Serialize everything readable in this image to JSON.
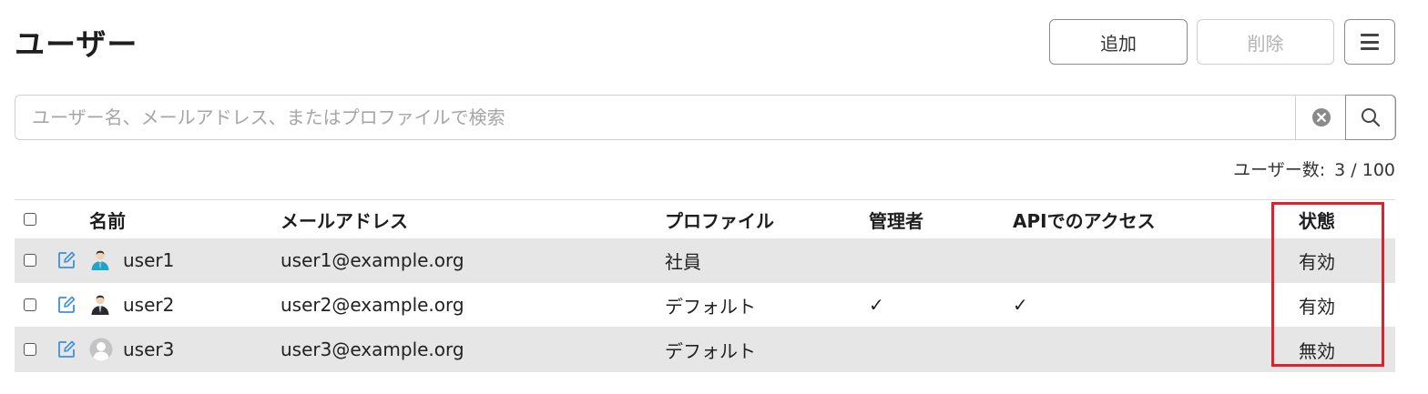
{
  "page": {
    "title": "ユーザー"
  },
  "toolbar": {
    "add_label": "追加",
    "delete_label": "削除",
    "menu_icon": "hamburger-menu-icon"
  },
  "search": {
    "placeholder": "ユーザー名、メールアドレス、またはプロファイルで検索",
    "value": "",
    "clear_icon": "clear-circle-icon",
    "search_icon": "magnifier-icon"
  },
  "user_count": {
    "label": "ユーザー数:",
    "value": "3 / 100"
  },
  "table": {
    "headers": {
      "name": "名前",
      "email": "メールアドレス",
      "profile": "プロファイル",
      "admin": "管理者",
      "api": "APIでのアクセス",
      "status": "状態"
    },
    "rows": [
      {
        "name": "user1",
        "email": "user1@example.org",
        "profile": "社員",
        "admin": "",
        "api": "",
        "status": "有効",
        "avatar": "user-teal-tie-icon"
      },
      {
        "name": "user2",
        "email": "user2@example.org",
        "profile": "デフォルト",
        "admin": "✓",
        "api": "✓",
        "status": "有効",
        "avatar": "user-black-tie-icon"
      },
      {
        "name": "user3",
        "email": "user3@example.org",
        "profile": "デフォルト",
        "admin": "",
        "api": "",
        "status": "無効",
        "avatar": "user-gray-default-icon"
      }
    ]
  },
  "colors": {
    "highlight": "#e0202a",
    "edit_icon": "#3d8fe0",
    "row_shade": "#e6e6e6"
  }
}
